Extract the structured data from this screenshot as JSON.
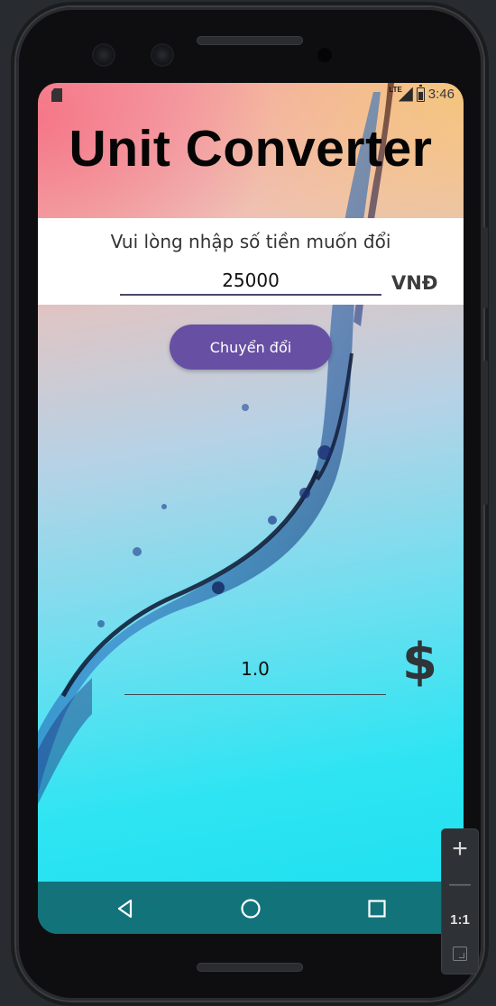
{
  "app": {
    "title": "Unit Converter"
  },
  "status_bar": {
    "network": "LTE",
    "time": "3:46"
  },
  "converter": {
    "prompt": "Vui lòng nhập số tiền muốn đổi",
    "source_value": "25000",
    "source_unit": "VNĐ",
    "convert_button": "Chuyển đổi",
    "result_value": "1.0",
    "result_unit": "$"
  },
  "navigation": {
    "icons": [
      "back-icon",
      "home-icon",
      "recents-icon"
    ]
  },
  "emulator_zoom": {
    "zoom_in": "+",
    "zoom_out": "—",
    "actual_size": "1:1"
  },
  "colors": {
    "button": "#6750a4",
    "nav_bar": "#126970",
    "input_panel": "#ffffff"
  }
}
